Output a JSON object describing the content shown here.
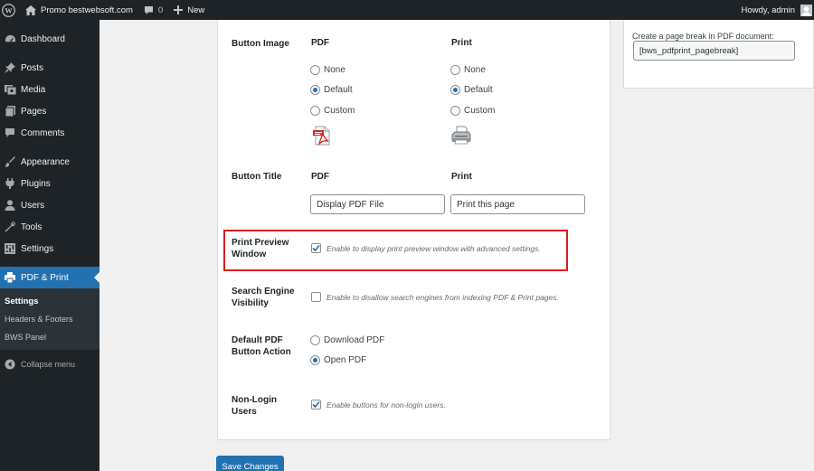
{
  "adminbar": {
    "site_name": "Promo bestwebsoft.com",
    "comments_count": "0",
    "new_label": "New",
    "howdy": "Howdy, admin"
  },
  "sidebar": {
    "items": [
      {
        "label": "Dashboard",
        "icon": "dashboard-icon"
      },
      {
        "label": "Posts",
        "icon": "pin-icon"
      },
      {
        "label": "Media",
        "icon": "media-icon"
      },
      {
        "label": "Pages",
        "icon": "page-icon"
      },
      {
        "label": "Comments",
        "icon": "comment-icon"
      },
      {
        "label": "Appearance",
        "icon": "brush-icon"
      },
      {
        "label": "Plugins",
        "icon": "plugin-icon"
      },
      {
        "label": "Users",
        "icon": "user-icon"
      },
      {
        "label": "Tools",
        "icon": "wrench-icon"
      },
      {
        "label": "Settings",
        "icon": "settings-icon"
      },
      {
        "label": "PDF & Print",
        "icon": "pdf-print-icon"
      }
    ],
    "submenu": [
      "Settings",
      "Headers & Footers",
      "BWS Panel"
    ],
    "collapse": "Collapse menu"
  },
  "form": {
    "button_image": {
      "label": "Button Image",
      "pdf_head": "PDF",
      "print_head": "Print",
      "options": [
        "None",
        "Default",
        "Custom"
      ],
      "pdf_selected": "Default",
      "print_selected": "Default"
    },
    "button_title": {
      "label": "Button Title",
      "pdf_head": "PDF",
      "print_head": "Print",
      "pdf_value": "Display PDF File",
      "print_value": "Print this page"
    },
    "print_preview": {
      "label_line1": "Print Preview",
      "label_line2": "Window",
      "checked": true,
      "description": "Enable to display print preview window with advanced settings."
    },
    "search_engine": {
      "label_line1": "Search Engine",
      "label_line2": "Visibility",
      "checked": false,
      "description": "Enable to disallow search engines from indexing PDF & Print pages."
    },
    "default_pdf_action": {
      "label_line1": "Default PDF",
      "label_line2": "Button Action",
      "options": [
        "Download PDF",
        "Open PDF"
      ],
      "selected": "Open PDF"
    },
    "non_login": {
      "label_line1": "Non-Login",
      "label_line2": "Users",
      "checked": true,
      "description": "Enable buttons for non-login users."
    },
    "save_label": "Save Changes"
  },
  "metabox": {
    "label": "Create a page break in PDF document:",
    "value": "[bws_pdfprint_pagebreak]"
  },
  "colors": {
    "accent": "#2271b1",
    "sidebar_bg": "#1d2327",
    "highlight": "#e21b1b"
  }
}
